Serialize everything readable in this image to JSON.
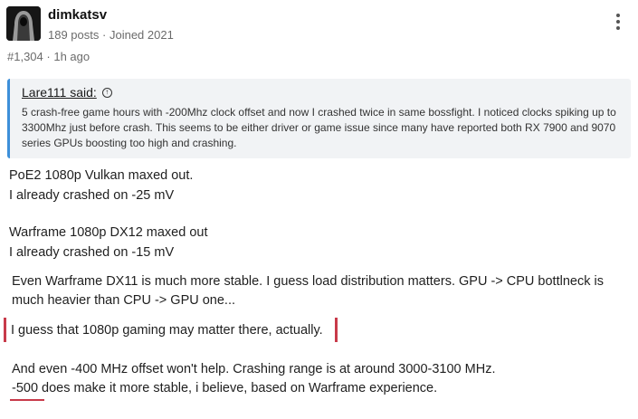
{
  "post": {
    "username": "dimkatsv",
    "posts": "189 posts",
    "separator": "·",
    "joined": "Joined 2021",
    "number": "#1,304",
    "time": "1h ago"
  },
  "quote": {
    "author": "Lare111 said:",
    "body": "5 crash-free game hours with -200Mhz clock offset and now I crashed twice in same bossfight. I noticed clocks spiking up to 3300Mhz just before crash. This seems to be either driver or game issue since many have reported both RX 7900 and 9070 series GPUs boosting too high and crashing."
  },
  "content": {
    "line1": "PoE2 1080p Vulkan maxed out.",
    "line2": "I already crashed on -25 mV",
    "line3": "Warframe 1080p DX12 maxed out",
    "line4": "I already crashed on -15 mV",
    "para1": "Even Warframe DX11 is much more stable. I guess load distribution matters. GPU -> CPU bottlneck is much heavier than CPU -> GPU one...",
    "highlight": "I guess that 1080p gaming may matter there, actually.",
    "line5": "And even -400 MHz offset won't help. Crashing range is at around 3000-3100 MHz.",
    "line6": "-500 does make it more stable, i believe, based on Warframe experience."
  },
  "colors": {
    "quote_accent": "#3d8fd9",
    "annotation_red": "#c83a4a"
  }
}
